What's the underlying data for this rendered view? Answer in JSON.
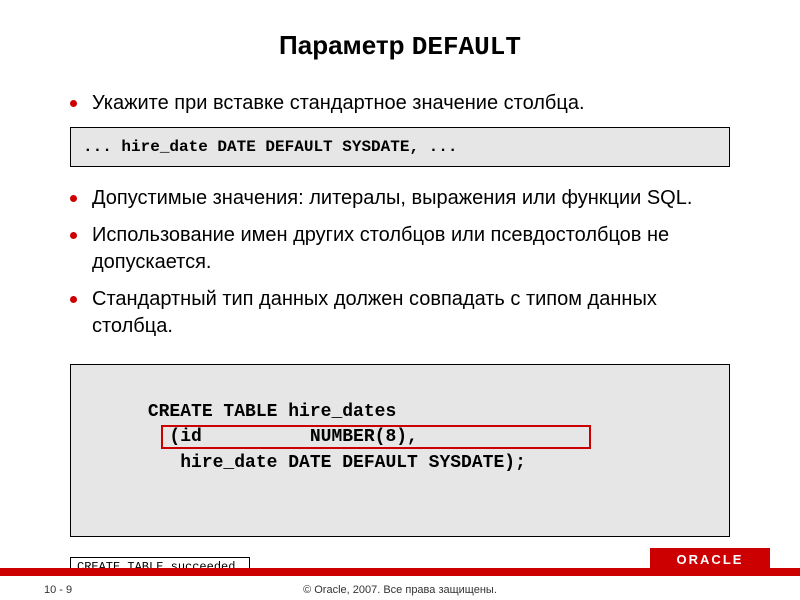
{
  "title": {
    "prefix": "Параметр ",
    "keyword": "DEFAULT"
  },
  "bullets": {
    "b1": "Укажите при вставке стандартное значение столбца.",
    "b2": "Допустимые значения: литералы, выражения или функции SQL.",
    "b3": "Использование имен других столбцов или псевдостолбцов не допускается.",
    "b4": "Стандартный тип данных должен совпадать с типом данных столбца."
  },
  "code1": "... hire_date DATE DEFAULT SYSDATE, ...",
  "code2": "CREATE TABLE hire_dates\n        (id          NUMBER(8),\n         hire_date DATE DEFAULT SYSDATE);",
  "result": "CREATE TABLE succeeded.",
  "footer": {
    "page": "10 - 9",
    "copyright": "© Oracle, 2007. Все права защищены.",
    "logo": "ORACLE"
  }
}
